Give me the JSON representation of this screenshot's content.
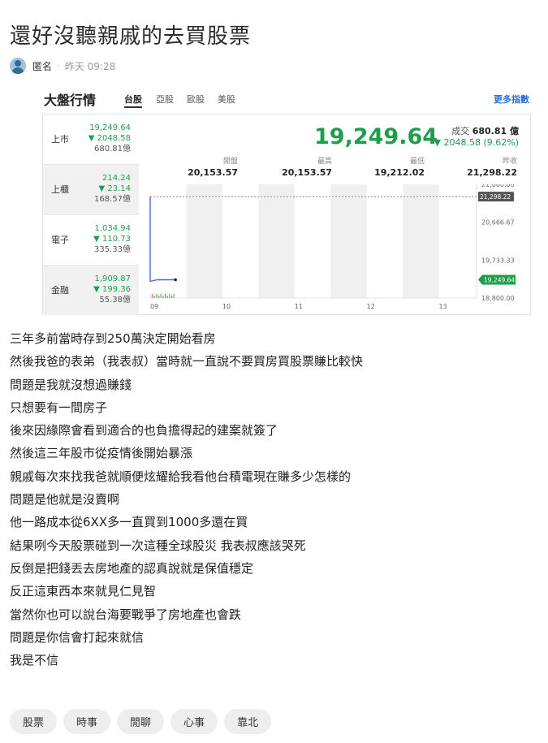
{
  "post": {
    "title": "還好沒聽親戚的去買股票",
    "author": "匿名",
    "time": "昨天 09:28",
    "paragraphs": [
      "三年多前當時存到250萬決定開始看房",
      "然後我爸的表弟（我表叔）當時就一直說不要買房買股票賺比較快",
      "問題是我就沒想過賺錢",
      "只想要有一間房子",
      "後來因緣際會看到適合的也負擔得起的建案就簽了",
      "然後這三年股市從疫情後開始暴漲",
      "親戚每次來找我爸就順便炫耀給我看他台積電現在賺多少怎樣的",
      "問題是他就是沒賣啊",
      "他一路成本從6XX多一直買到1000多還在買",
      "結果咧今天股票碰到一次這種全球股災 我表叔應該哭死",
      "反倒是把錢丟去房地產的認真說就是保值穩定",
      "反正這東西本來就見仁見智",
      "當然你也可以說台海要戰爭了房地產也會跌",
      "問題是你信會打起來就信",
      "我是不信"
    ],
    "tags": [
      "股票",
      "時事",
      "閒聊",
      "心事",
      "靠北"
    ]
  },
  "market": {
    "title": "大盤行情",
    "tabs": [
      "台股",
      "亞股",
      "歐股",
      "美股"
    ],
    "active_tab": "台股",
    "more_label": "更多指數",
    "indices": [
      {
        "name": "上市",
        "value": "19,249.64",
        "change": "▼ 2048.58",
        "volume": "680.81億"
      },
      {
        "name": "上櫃",
        "value": "214.24",
        "change": "▼ 23.14",
        "volume": "168.57億"
      },
      {
        "name": "電子",
        "value": "1,034.94",
        "change": "▼ 110.73",
        "volume": "335.33億"
      },
      {
        "name": "金融",
        "value": "1,909.87",
        "change": "▼ 199.36",
        "volume": "55.38億"
      }
    ],
    "main_value": "19,249.64",
    "turnover_label": "成交",
    "turnover_value": "680.81 億",
    "change": "▼ 2048.58 (9.62%)",
    "stats": [
      {
        "label": "開盤",
        "value": "20,153.57"
      },
      {
        "label": "最高",
        "value": "20,153.57"
      },
      {
        "label": "最低",
        "value": "19,212.02"
      },
      {
        "label": "昨收",
        "value": "21,298.22"
      }
    ],
    "colors": {
      "down": "#1e9e4a",
      "line": "#3b6fd8",
      "link": "#2a6fd6"
    }
  },
  "chart_data": {
    "type": "line",
    "x_ticks": [
      "09",
      "10",
      "11",
      "12",
      "13"
    ],
    "y_ticks": [
      "21,600.00",
      "20,666.67",
      "19,733.33",
      "18,800.00"
    ],
    "ylim": [
      18800,
      21600
    ],
    "prev_close": 21298.22,
    "prev_close_label": "21,298.22",
    "last_label": "19,249.64",
    "series": [
      {
        "values": [
          {
            "t": 9.0,
            "y": 21298.22
          },
          {
            "t": 9.0,
            "y": 20153.57
          },
          {
            "t": 9.0,
            "y": 19212.02
          },
          {
            "t": 9.1,
            "y": 19249.64
          },
          {
            "t": 9.35,
            "y": 19249.64
          }
        ]
      }
    ]
  }
}
